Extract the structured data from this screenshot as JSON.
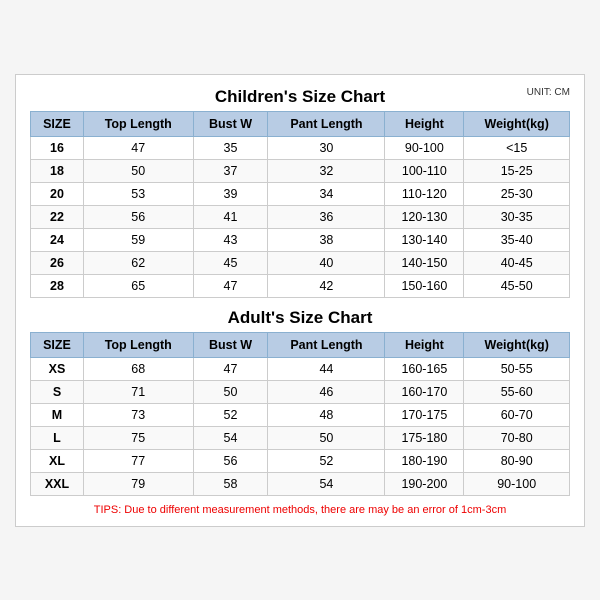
{
  "children_title": "Children's Size Chart",
  "adult_title": "Adult's Size Chart",
  "unit": "UNIT: CM",
  "headers": [
    "SIZE",
    "Top Length",
    "Bust W",
    "Pant Length",
    "Height",
    "Weight(kg)"
  ],
  "children_rows": [
    [
      "16",
      "47",
      "35",
      "30",
      "90-100",
      "<15"
    ],
    [
      "18",
      "50",
      "37",
      "32",
      "100-110",
      "15-25"
    ],
    [
      "20",
      "53",
      "39",
      "34",
      "110-120",
      "25-30"
    ],
    [
      "22",
      "56",
      "41",
      "36",
      "120-130",
      "30-35"
    ],
    [
      "24",
      "59",
      "43",
      "38",
      "130-140",
      "35-40"
    ],
    [
      "26",
      "62",
      "45",
      "40",
      "140-150",
      "40-45"
    ],
    [
      "28",
      "65",
      "47",
      "42",
      "150-160",
      "45-50"
    ]
  ],
  "adult_rows": [
    [
      "XS",
      "68",
      "47",
      "44",
      "160-165",
      "50-55"
    ],
    [
      "S",
      "71",
      "50",
      "46",
      "160-170",
      "55-60"
    ],
    [
      "M",
      "73",
      "52",
      "48",
      "170-175",
      "60-70"
    ],
    [
      "L",
      "75",
      "54",
      "50",
      "175-180",
      "70-80"
    ],
    [
      "XL",
      "77",
      "56",
      "52",
      "180-190",
      "80-90"
    ],
    [
      "XXL",
      "79",
      "58",
      "54",
      "190-200",
      "90-100"
    ]
  ],
  "tips": "TIPS: Due to different measurement methods, there are may be an error of 1cm-3cm"
}
